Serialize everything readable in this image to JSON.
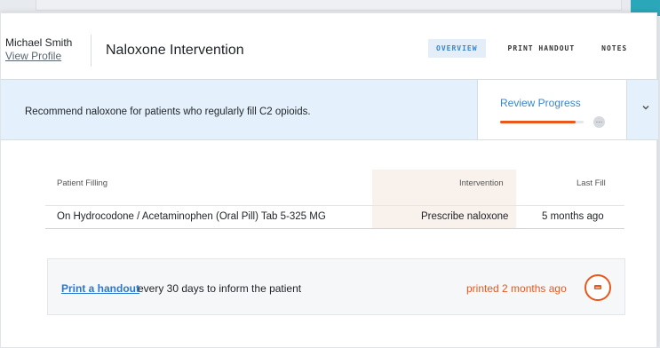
{
  "header": {
    "patient_name": "Michael Smith",
    "view_profile": "View Profile",
    "title": "Naloxone Intervention",
    "tabs": [
      {
        "label": "OVERVIEW",
        "active": true
      },
      {
        "label": "PRINT HANDOUT",
        "active": false
      },
      {
        "label": "NOTES",
        "active": false
      }
    ]
  },
  "banner": {
    "text": "Recommend naloxone for patients who regularly fill C2 opioids.",
    "progress_label": "Review Progress",
    "progress_fraction": 0.9,
    "more_icon": "ellipsis-icon",
    "expand_icon": "chevron-down-icon"
  },
  "table": {
    "headers": [
      "Patient Filling",
      "Intervention",
      "Last Fill"
    ],
    "rows": [
      [
        "On Hydrocodone / Acetaminophen (Oral Pill) Tab 5-325 MG",
        "Prescribe naloxone",
        "5 months ago"
      ]
    ]
  },
  "handout": {
    "link": "Print a handout",
    "text": "every 30 days to inform the patient",
    "printed": "printed 2 months ago",
    "icon": "print-icon"
  },
  "colors": {
    "accent_blue": "#3a86c8",
    "accent_orange": "#e8581c",
    "banner_bg": "#e4f0fb"
  }
}
